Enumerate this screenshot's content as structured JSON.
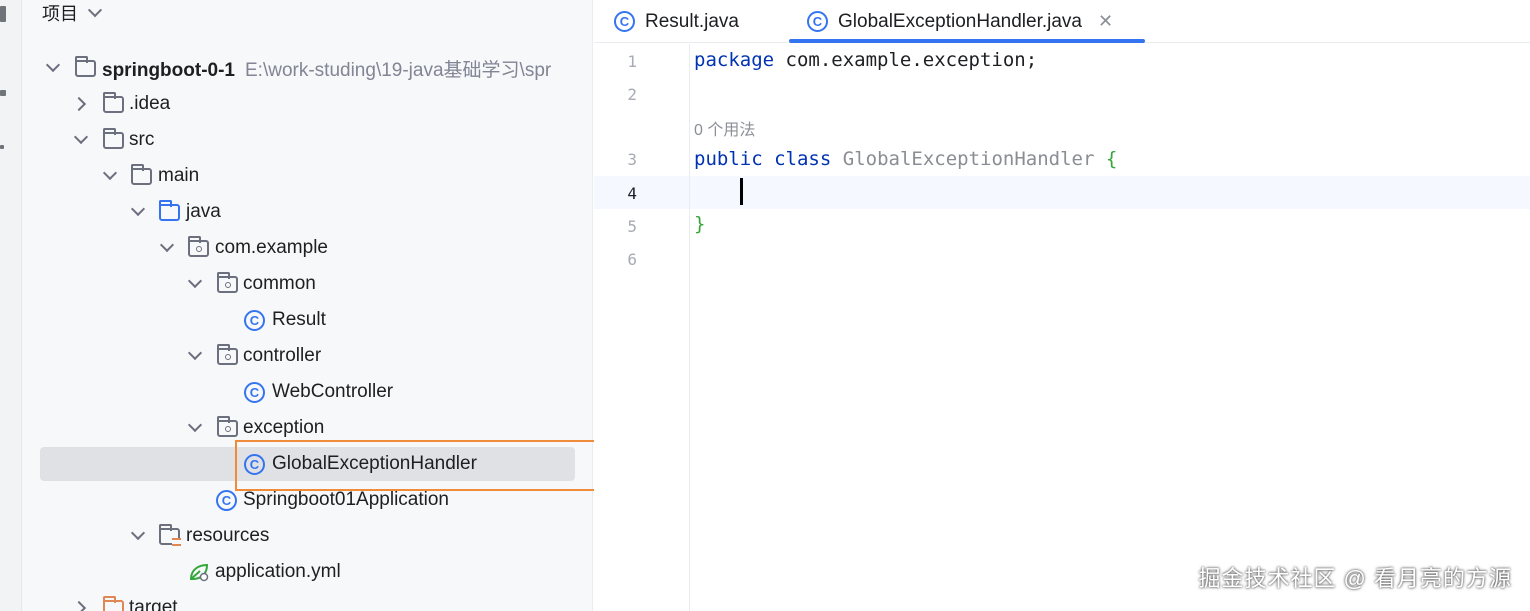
{
  "panel": {
    "title": "项目"
  },
  "tree": {
    "root": {
      "label": "springboot-0-1",
      "path": "E:\\work-studing\\19-java基础学习\\spr"
    },
    "idea": ".idea",
    "src": "src",
    "main": "main",
    "java": "java",
    "com_example": "com.example",
    "common": "common",
    "result": "Result",
    "controller": "controller",
    "web_controller": "WebController",
    "exception": "exception",
    "global_handler": "GlobalExceptionHandler",
    "application": "Springboot01Application",
    "resources": "resources",
    "application_yml": "application.yml",
    "target": "target"
  },
  "tabs": [
    {
      "label": "Result.java",
      "active": false
    },
    {
      "label": "GlobalExceptionHandler.java",
      "active": true
    }
  ],
  "editor": {
    "line_numbers": [
      "1",
      "2",
      "3",
      "4",
      "5",
      "6"
    ],
    "line1": {
      "kw": "package",
      "rest": " com.example.exception;"
    },
    "usages_hint": "0 个用法",
    "line3": {
      "kw1": "public",
      "kw2": "class",
      "name": "GlobalExceptionHandler",
      "brace": "{"
    },
    "line5": {
      "brace": "}"
    }
  },
  "watermark": "掘金技术社区 @ 看月亮的方源",
  "colors": {
    "accent": "#3574f0",
    "highlight_box": "#f08b3a",
    "keyword": "#0033b3",
    "brace": "#35a63a"
  }
}
